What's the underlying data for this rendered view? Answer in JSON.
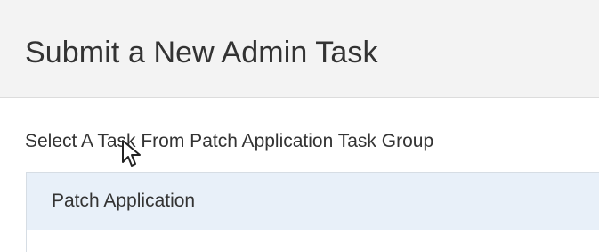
{
  "page": {
    "title": "Submit a New Admin Task",
    "subtitle": "Select A Task From Patch Application Task Group"
  },
  "task_list": {
    "items": [
      {
        "label": "Patch Application",
        "selected": true
      }
    ]
  },
  "colors": {
    "header_bg": "#f3f3f3",
    "selected_row_bg": "#e8f0f9",
    "text": "#333333"
  },
  "icons": {
    "cursor": "mouse-pointer-icon"
  }
}
